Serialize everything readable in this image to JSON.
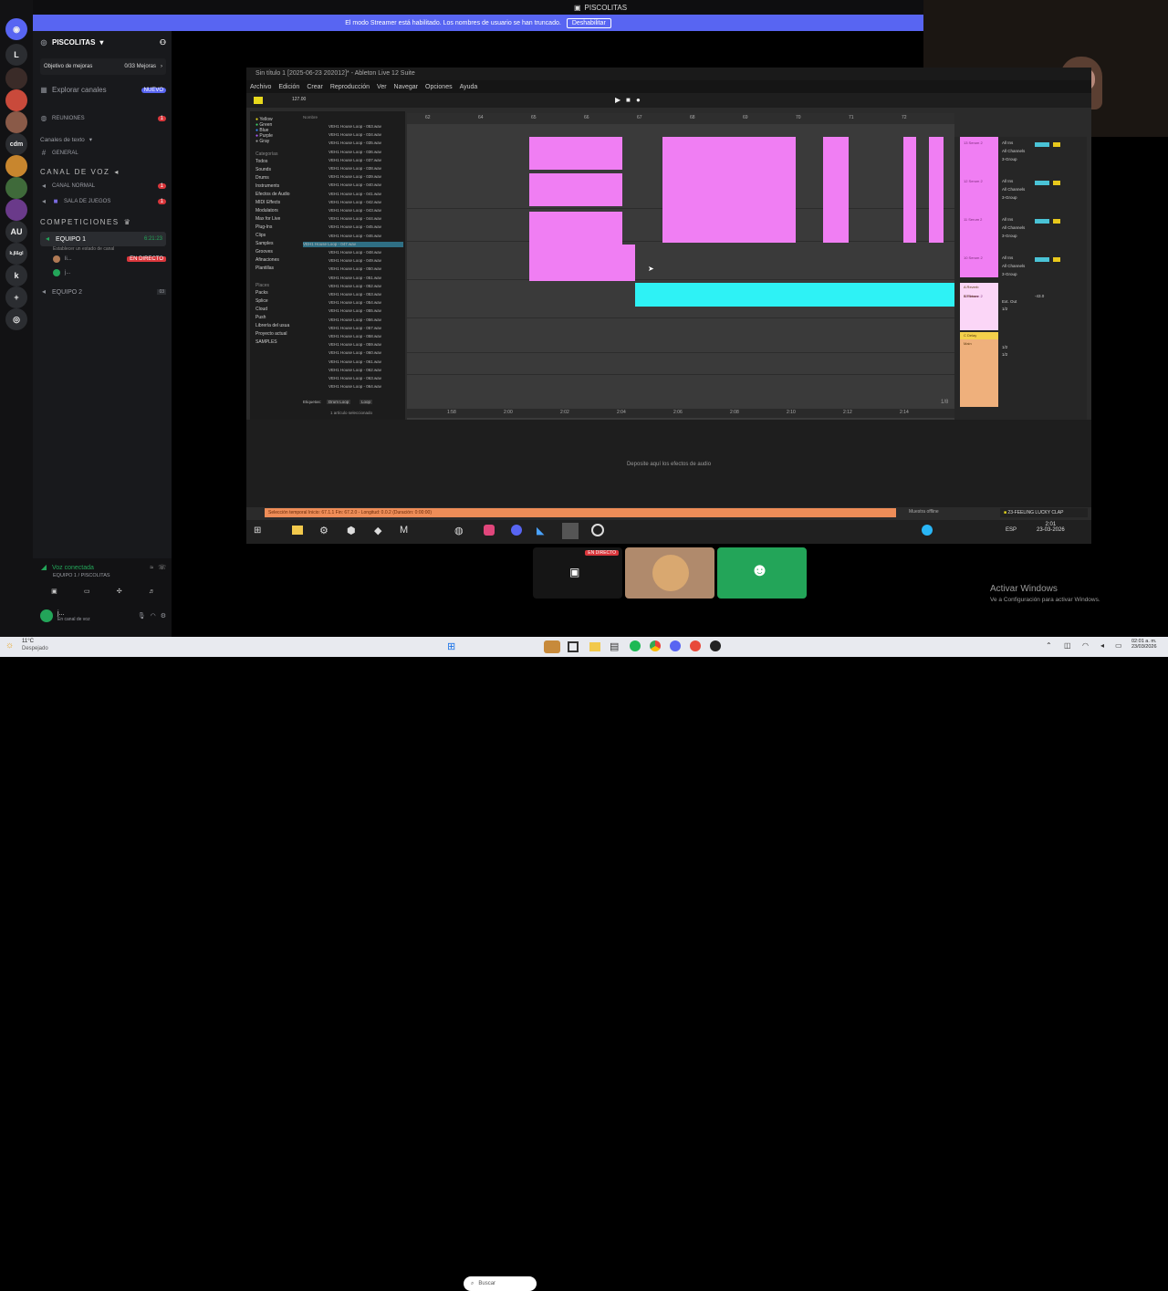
{
  "window": {
    "title": "PISCOLITAS"
  },
  "banner": {
    "text": "El modo Streamer está habilitado. Los nombres de usuario se han truncado.",
    "button": "Deshabilitar"
  },
  "rail": {
    "items": [
      "L",
      "cdm",
      "AU",
      "k.jl&gl",
      "k"
    ]
  },
  "sidebar": {
    "server_name": "PISCOLITAS",
    "goal_label": "Objetivo de mejoras",
    "goal_progress": "0/33 Mejoras",
    "explore": "Explorar canales",
    "explore_badge": "NUEVO",
    "reuniones": "REUNIONES",
    "text_category": "Canales de texto",
    "general": "GENERAL",
    "voice_category": "CANAL DE VOZ",
    "canal_normal": "CANAL NORMAL",
    "sala_juegos": "SALA DE JUEGOS",
    "competiciones": "COMPETICIONES",
    "equipo1": "EQUIPO 1",
    "equipo1_time": "6:21:23",
    "equipo1_status": "Establecer un estado de canal",
    "live_badge": "EN DIRECTO",
    "user1": "li...",
    "user2": "j...",
    "equipo2": "EQUIPO 2",
    "equipo2_count": "03",
    "voice_connected": "Voz conectada",
    "voice_location": "EQUIPO 1 / PISCOLITAS",
    "me_name": "j...",
    "me_status": "En canal de voz"
  },
  "ableton": {
    "title": "Sin título 1 [2025-06-23 202012]* - Ableton Live 12 Suite",
    "menu": [
      "Archivo",
      "Edición",
      "Crear",
      "Reproducción",
      "Ver",
      "Navegar",
      "Opciones",
      "Ayuda"
    ],
    "tempo": "127.00",
    "categories_colors": [
      "Yellow",
      "Green",
      "Blue",
      "Purple",
      "Gray"
    ],
    "categories_header": "Categorías",
    "categories": [
      "Todos",
      "Sounds",
      "Drums",
      "Instruments",
      "Efectos de Audio",
      "MIDI Effects",
      "Modulators",
      "Max for Live",
      "Plug-Ins",
      "Clips",
      "Samples",
      "Grooves",
      "Afinaciones",
      "Plantillas"
    ],
    "places_header": "Places",
    "places": [
      "Packs",
      "Splice",
      "Cloud",
      "Push",
      "Librería del usua",
      "Proyecto actual",
      "SAMPLES"
    ],
    "files_header": "Nombre",
    "files": [
      "VEH1 House Loop - 053.wav",
      "VEH1 House Loop - 034.wav",
      "VEH1 House Loop - 035.wav",
      "VEH1 House Loop - 036.wav",
      "VEH1 House Loop - 037.wav",
      "VEH1 House Loop - 038.wav",
      "VEH1 House Loop - 039.wav",
      "VEH1 House Loop - 040.wav",
      "VEH1 House Loop - 041.wav",
      "VEH1 House Loop - 042.wav",
      "VEH1 House Loop - 043.wav",
      "VEH1 House Loop - 044.wav",
      "VEH1 House Loop - 045.wav",
      "VEH1 House Loop - 046.wav",
      "VEH1 House Loop - 047.wav",
      "VEH1 House Loop - 048.wav",
      "VEH1 House Loop - 049.wav",
      "VEH1 House Loop - 050.wav",
      "VEH1 House Loop - 051.wav",
      "VEH1 House Loop - 052.wav",
      "VEH1 House Loop - 053.wav",
      "VEH1 House Loop - 054.wav",
      "VEH1 House Loop - 055.wav",
      "VEH1 House Loop - 056.wav",
      "VEH1 House Loop - 057.wav",
      "VEH1 House Loop - 058.wav",
      "VEH1 House Loop - 059.wav",
      "VEH1 House Loop - 060.wav",
      "VEH1 House Loop - 061.wav",
      "VEH1 House Loop - 062.wav",
      "VEH1 House Loop - 063.wav",
      "VEH1 House Loop - 064.wav"
    ],
    "selected_file_index": 14,
    "tags_label": "Etiquetas:",
    "tag_values": [
      "Drum Loop",
      "Loop"
    ],
    "selection_info": "1 artículo seleccionado",
    "ruler": [
      "62",
      "64",
      "65",
      "66",
      "67",
      "68",
      "69",
      "70",
      "71",
      "72"
    ],
    "time_ruler": [
      "1:58",
      "2:00",
      "2:02",
      "2:04",
      "2:06",
      "2:08",
      "2:10",
      "2:12",
      "2:14"
    ],
    "page_counter": "1/8",
    "drop_hint": "Deposite aquí los efectos de audio",
    "status_text": "Selección temporal Inicio: 67.1.1 Fin: 67.2.0 - Longitud: 0.0.2 (Duración: 0:00:00)",
    "status_right": "Muestra offline",
    "status_clip": "23-FEELING LUCKY CLAP",
    "mixer_tracks": [
      "13 Serum 2",
      "12 Serum 2",
      "11 Serum 2",
      "10 Serum 2",
      "13 Serum 2"
    ],
    "returns": [
      "A Reverb",
      "B Return",
      "C Delay",
      "Main"
    ],
    "mixer_in": "All Ins",
    "mixer_channels": "All Channels",
    "mixer_group": "3-Group",
    "mixer_out": "Ext. Out",
    "mixer_val": "1/2",
    "mixer_db": "-43.0"
  },
  "in_taskbar": {
    "language": "ESP",
    "time": "2:01",
    "date": "23-03-2026"
  },
  "participants": {
    "live_badge": "EN DIRECTO"
  },
  "activate": {
    "title": "Activar Windows",
    "sub": "Ve a Configuración para activar Windows."
  },
  "win_taskbar": {
    "weather_temp": "11°C",
    "weather_desc": "Despejado",
    "search_placeholder": "Buscar",
    "time": "02:01 a. m.",
    "date": "23/03/2026"
  },
  "colors": {
    "accent": "#5865f2",
    "clip_pink": "#f07ef3",
    "clip_cyan": "#2ef2f5",
    "status_orange": "#ee8d58",
    "discord_green": "#23a559"
  }
}
